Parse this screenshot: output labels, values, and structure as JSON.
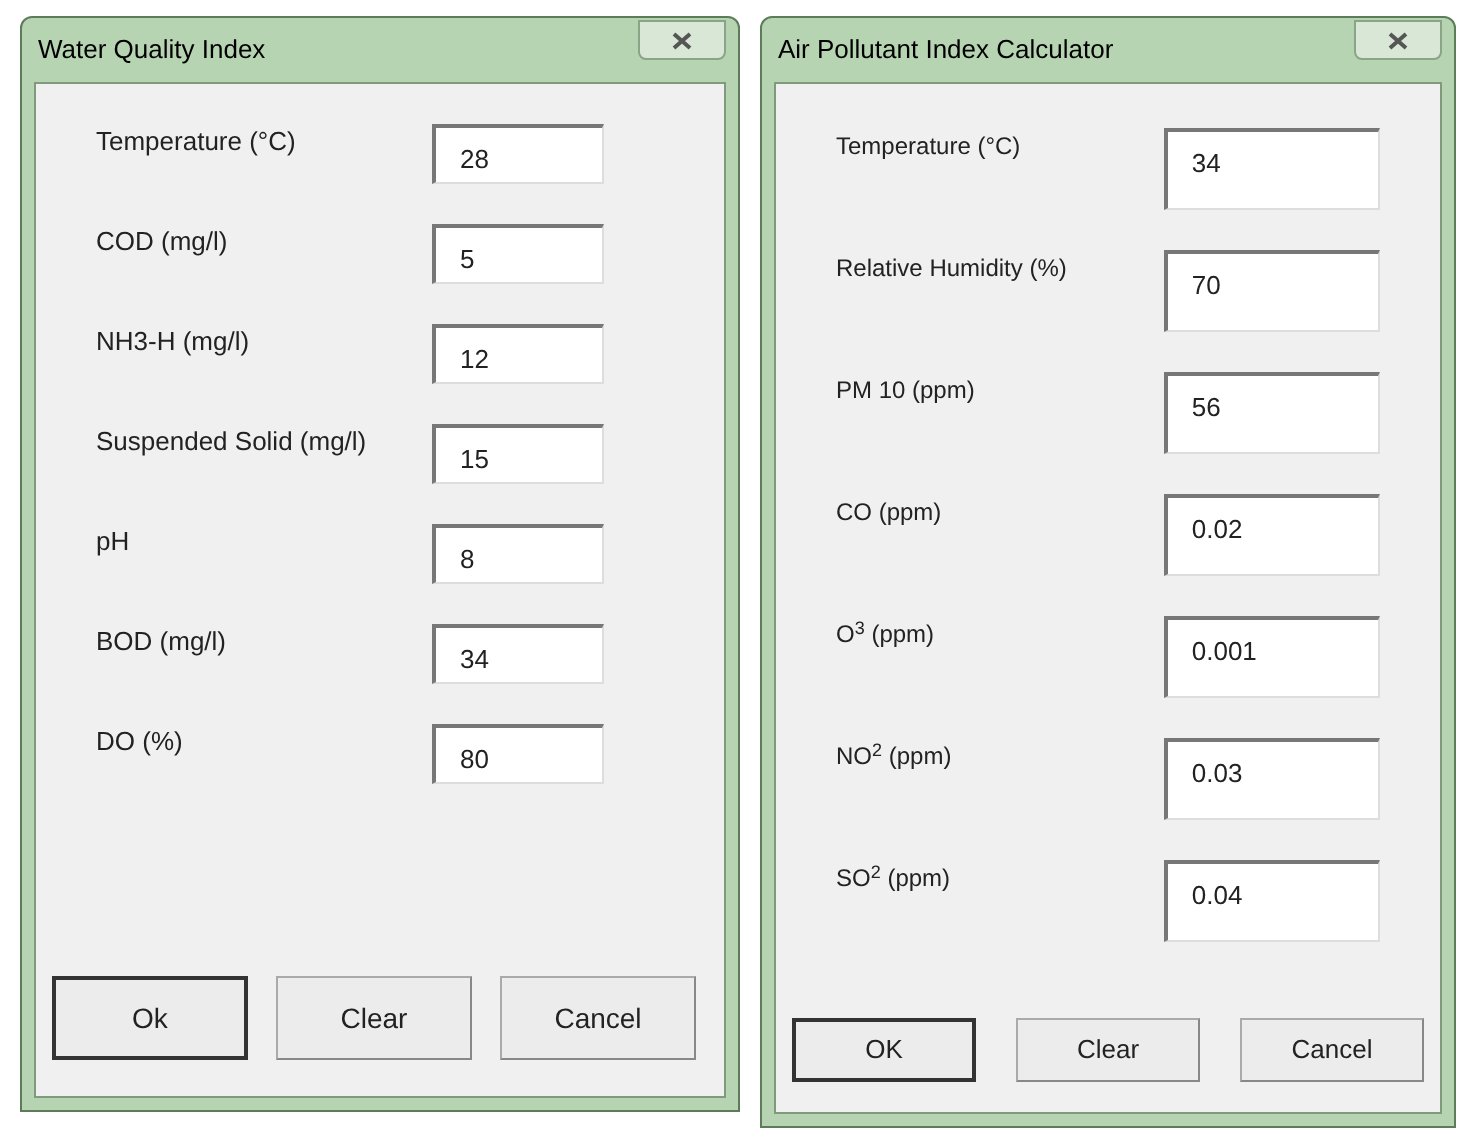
{
  "windows": [
    {
      "title": "Water Quality Index",
      "fields": [
        {
          "label": "Temperature (°C)",
          "value": "28"
        },
        {
          "label": "COD (mg/l)",
          "value": "5"
        },
        {
          "label": "NH3-H (mg/l)",
          "value": "12"
        },
        {
          "label": "Suspended Solid (mg/l)",
          "value": "15"
        },
        {
          "label": "pH",
          "value": "8"
        },
        {
          "label": "BOD (mg/l)",
          "value": "34"
        },
        {
          "label": "DO (%)",
          "value": "80"
        }
      ],
      "buttons": [
        {
          "label": "Ok",
          "default": true
        },
        {
          "label": "Clear",
          "default": false
        },
        {
          "label": "Cancel",
          "default": false
        }
      ]
    },
    {
      "title": "Air Pollutant Index Calculator",
      "fields": [
        {
          "label": "Temperature (°C)",
          "value": "34"
        },
        {
          "label": "Relative Humidity (%)",
          "value": "70"
        },
        {
          "label": "PM 10 (ppm)",
          "value": "56"
        },
        {
          "label": "CO (ppm)",
          "value": "0.02"
        },
        {
          "label": "O$^{3}$ (ppm)",
          "value": "0.001"
        },
        {
          "label": "NO$^{2}$ (ppm)",
          "value": "0.03"
        },
        {
          "label": "SO$^{2}$ (ppm)",
          "value": "0.04"
        }
      ],
      "buttons": [
        {
          "label": "OK",
          "default": true
        },
        {
          "label": "Clear",
          "default": false
        },
        {
          "label": "Cancel",
          "default": false
        }
      ]
    }
  ]
}
